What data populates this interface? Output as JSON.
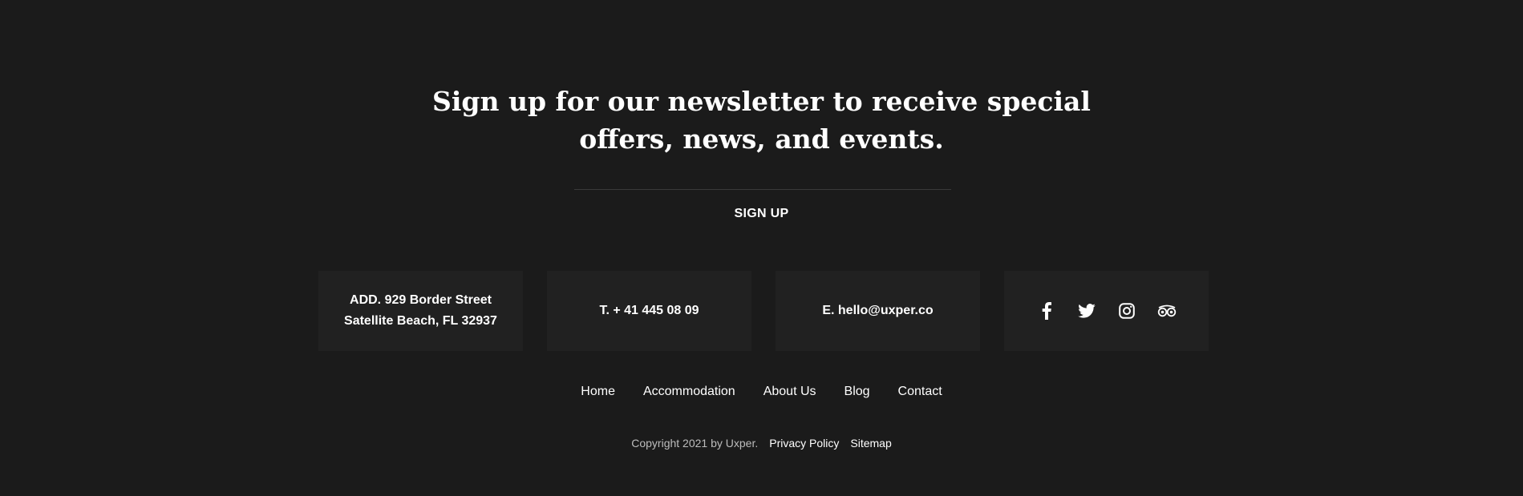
{
  "newsletter": {
    "title_line1": "Sign up for our newsletter to receive special",
    "title_line2": "offers, news, and events.",
    "signup_label": "SIGN UP"
  },
  "contact": {
    "address_line1": "ADD. 929 Border Street",
    "address_line2": "Satellite Beach, FL 32937",
    "phone": "T. + 41 445 08 09",
    "email": "E. hello@uxper.co"
  },
  "social": {
    "icons": [
      "facebook-icon",
      "twitter-icon",
      "instagram-icon",
      "tripadvisor-icon"
    ]
  },
  "footer_nav": {
    "items": [
      "Home",
      "Accommodation",
      "About Us",
      "Blog",
      "Contact"
    ]
  },
  "copyright": {
    "text": "Copyright 2021 by Uxper.",
    "privacy_label": "Privacy Policy",
    "sitemap_label": "Sitemap"
  },
  "colors": {
    "background": "#1b1b1b",
    "box_background": "#212121",
    "text": "#ffffff",
    "muted_text": "#bdbdbd"
  }
}
